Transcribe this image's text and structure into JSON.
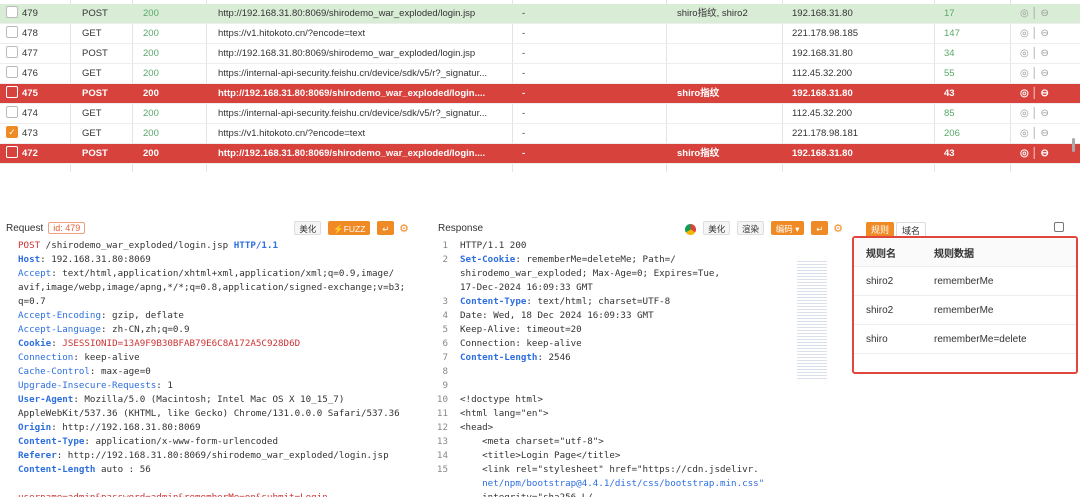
{
  "rows": [
    {
      "id": "479",
      "method": "POST",
      "status": "200",
      "url": "http://192.168.31.80:8069/shirodemo_war_exploded/login.jsp",
      "d1": "-",
      "tag": "shiro指纹, shiro2",
      "ip": "192.168.31.80",
      "len": "17",
      "style": "sel",
      "checked": false
    },
    {
      "id": "478",
      "method": "GET",
      "status": "200",
      "url": "https://v1.hitokoto.cn/?encode=text",
      "d1": "-",
      "tag": "",
      "ip": "221.178.98.185",
      "len": "147",
      "style": "",
      "checked": false
    },
    {
      "id": "477",
      "method": "POST",
      "status": "200",
      "url": "http://192.168.31.80:8069/shirodemo_war_exploded/login.jsp",
      "d1": "-",
      "tag": "",
      "ip": "192.168.31.80",
      "len": "34",
      "style": "",
      "checked": false
    },
    {
      "id": "476",
      "method": "GET",
      "status": "200",
      "url": "https://internal-api-security.feishu.cn/device/sdk/v5/r?_signatur...",
      "d1": "-",
      "tag": "",
      "ip": "112.45.32.200",
      "len": "55",
      "style": "",
      "checked": false
    },
    {
      "id": "475",
      "method": "POST",
      "status": "200",
      "url": "http://192.168.31.80:8069/shirodemo_war_exploded/login....",
      "d1": "-",
      "tag": "shiro指纹",
      "ip": "192.168.31.80",
      "len": "43",
      "style": "red",
      "checked": false
    },
    {
      "id": "474",
      "method": "GET",
      "status": "200",
      "url": "https://internal-api-security.feishu.cn/device/sdk/v5/r?_signatur...",
      "d1": "-",
      "tag": "",
      "ip": "112.45.32.200",
      "len": "85",
      "style": "",
      "checked": false
    },
    {
      "id": "473",
      "method": "GET",
      "status": "200",
      "url": "https://v1.hitokoto.cn/?encode=text",
      "d1": "-",
      "tag": "",
      "ip": "221.178.98.181",
      "len": "206",
      "style": "",
      "checked": true
    },
    {
      "id": "472",
      "method": "POST",
      "status": "200",
      "url": "http://192.168.31.80:8069/shirodemo_war_exploded/login....",
      "d1": "-",
      "tag": "shiro指纹",
      "ip": "192.168.31.80",
      "len": "43",
      "style": "red",
      "checked": false
    }
  ],
  "request": {
    "title": "Request",
    "id_label": "id: 479",
    "beautify": "美化",
    "fuzz": "FUZZ",
    "lines": [
      [
        {
          "t": "POST",
          "c": "hl"
        },
        {
          "t": " /shirodemo_war_exploded/login.jsp ",
          "c": "v"
        },
        {
          "t": "HTTP/1.1",
          "c": "kb"
        }
      ],
      [
        {
          "t": "Host",
          "c": "kb"
        },
        {
          "t": ": 192.168.31.80:8069",
          "c": "v"
        }
      ],
      [
        {
          "t": "Accept",
          "c": "k"
        },
        {
          "t": ": text/html,application/xhtml+xml,application/xml;q=0.9,image/",
          "c": "v"
        }
      ],
      [
        {
          "t": "avif,image/webp,image/apng,*/*;q=0.8,application/signed-exchange;v=b3;",
          "c": "v"
        }
      ],
      [
        {
          "t": "q=0.7",
          "c": "v"
        }
      ],
      [
        {
          "t": "Accept-Encoding",
          "c": "k"
        },
        {
          "t": ": gzip, deflate",
          "c": "v"
        }
      ],
      [
        {
          "t": "Accept-Language",
          "c": "k"
        },
        {
          "t": ": zh-CN,zh;q=0.9",
          "c": "v"
        }
      ],
      [
        {
          "t": "Cookie",
          "c": "kb"
        },
        {
          "t": ": ",
          "c": "v"
        },
        {
          "t": "JSESSIONID=13A9F9B30BFAB79E6C8A172A5C928D6D",
          "c": "hl"
        }
      ],
      [
        {
          "t": "Connection",
          "c": "k"
        },
        {
          "t": ": keep-alive",
          "c": "v"
        }
      ],
      [
        {
          "t": "Cache-Control",
          "c": "k"
        },
        {
          "t": ": max-age=0",
          "c": "v"
        }
      ],
      [
        {
          "t": "Upgrade-Insecure-Requests",
          "c": "k"
        },
        {
          "t": ": 1",
          "c": "v"
        }
      ],
      [
        {
          "t": "User-Agent",
          "c": "kb"
        },
        {
          "t": ": Mozilla/5.0 (Macintosh; Intel Mac OS X 10_15_7)",
          "c": "v"
        }
      ],
      [
        {
          "t": "AppleWebKit/537.36 (KHTML, like Gecko) Chrome/131.0.0.0 Safari/537.36",
          "c": "v"
        }
      ],
      [
        {
          "t": "Origin",
          "c": "kb"
        },
        {
          "t": ": http://192.168.31.80:8069",
          "c": "v"
        }
      ],
      [
        {
          "t": "Content-Type",
          "c": "kb"
        },
        {
          "t": ": application/x-www-form-urlencoded",
          "c": "v"
        }
      ],
      [
        {
          "t": "Referer",
          "c": "kb"
        },
        {
          "t": ": http://192.168.31.80:8069/shirodemo_war_exploded/login.jsp",
          "c": "v"
        }
      ],
      [
        {
          "t": "Content-Length",
          "c": "kb"
        },
        {
          "t": " auto : 56",
          "c": "v"
        }
      ],
      [
        {
          "t": "",
          "c": "v"
        }
      ],
      [
        {
          "t": "username=admin&password=admin&rememberMe=on&submit=Login",
          "c": "hl"
        }
      ]
    ]
  },
  "response": {
    "title": "Response",
    "beautify": "美化",
    "render": "渲染",
    "encode": "编码",
    "lines": [
      {
        "n": "1",
        "p": [
          {
            "t": "HTTP/1.1 200",
            "c": "v"
          }
        ]
      },
      {
        "n": "2",
        "p": [
          {
            "t": "Set-Cookie",
            "c": "kb"
          },
          {
            "t": ": rememberMe=deleteMe; Path=/",
            "c": "v"
          }
        ]
      },
      {
        "n": "",
        "p": [
          {
            "t": "shirodemo_war_exploded; Max-Age=0; Expires=Tue,",
            "c": "v"
          }
        ]
      },
      {
        "n": "",
        "p": [
          {
            "t": "17-Dec-2024 16:09:33 GMT",
            "c": "v"
          }
        ]
      },
      {
        "n": "3",
        "p": [
          {
            "t": "Content-Type",
            "c": "kb"
          },
          {
            "t": ": text/html; charset=UTF-8",
            "c": "v"
          }
        ]
      },
      {
        "n": "4",
        "p": [
          {
            "t": "Date: Wed, 18 Dec 2024 16:09:33 GMT",
            "c": "v"
          }
        ]
      },
      {
        "n": "5",
        "p": [
          {
            "t": "Keep-Alive: timeout=20",
            "c": "v"
          }
        ]
      },
      {
        "n": "6",
        "p": [
          {
            "t": "Connection: keep-alive",
            "c": "v"
          }
        ]
      },
      {
        "n": "7",
        "p": [
          {
            "t": "Content-Length",
            "c": "kb"
          },
          {
            "t": ": 2546",
            "c": "v"
          }
        ]
      },
      {
        "n": "8",
        "p": [
          {
            "t": "",
            "c": "v"
          }
        ]
      },
      {
        "n": "9",
        "p": [
          {
            "t": "",
            "c": "v"
          }
        ]
      },
      {
        "n": "10",
        "p": [
          {
            "t": "<!doctype html>",
            "c": "v"
          }
        ]
      },
      {
        "n": "11",
        "p": [
          {
            "t": "<html lang=\"en\">",
            "c": "v"
          }
        ]
      },
      {
        "n": "12",
        "p": [
          {
            "t": "<head>",
            "c": "v"
          }
        ]
      },
      {
        "n": "13",
        "p": [
          {
            "t": "    <meta charset=\"utf-8\">",
            "c": "v"
          }
        ]
      },
      {
        "n": "14",
        "p": [
          {
            "t": "    <title>Login Page</title>",
            "c": "v"
          }
        ]
      },
      {
        "n": "15",
        "p": [
          {
            "t": "    <link rel=\"stylesheet\" href=\"https://cdn.jsdelivr.",
            "c": "v"
          }
        ]
      },
      {
        "n": "",
        "p": [
          {
            "t": "    net/npm/bootstrap@4.4.1/dist/css/bootstrap.min.css\"",
            "c": "k"
          }
        ]
      },
      {
        "n": "",
        "p": [
          {
            "t": "    integrity=\"sha256-L/",
            "c": "v"
          }
        ]
      }
    ]
  },
  "rules": {
    "tab_rules": "规则",
    "tab_domain": "域名",
    "header": {
      "name": "规则名",
      "data": "规则数据"
    },
    "rows": [
      {
        "name": "shiro2",
        "data": "rememberMe"
      },
      {
        "name": "shiro2",
        "data": "rememberMe"
      },
      {
        "name": "shiro",
        "data": "rememberMe=delete"
      }
    ]
  },
  "colors": {
    "selected_row": "#d9ecd6",
    "flag_row": "#d8423d",
    "accent": "#f08a24",
    "status_ok": "#5aa86a",
    "rule_border": "#e0463c"
  }
}
